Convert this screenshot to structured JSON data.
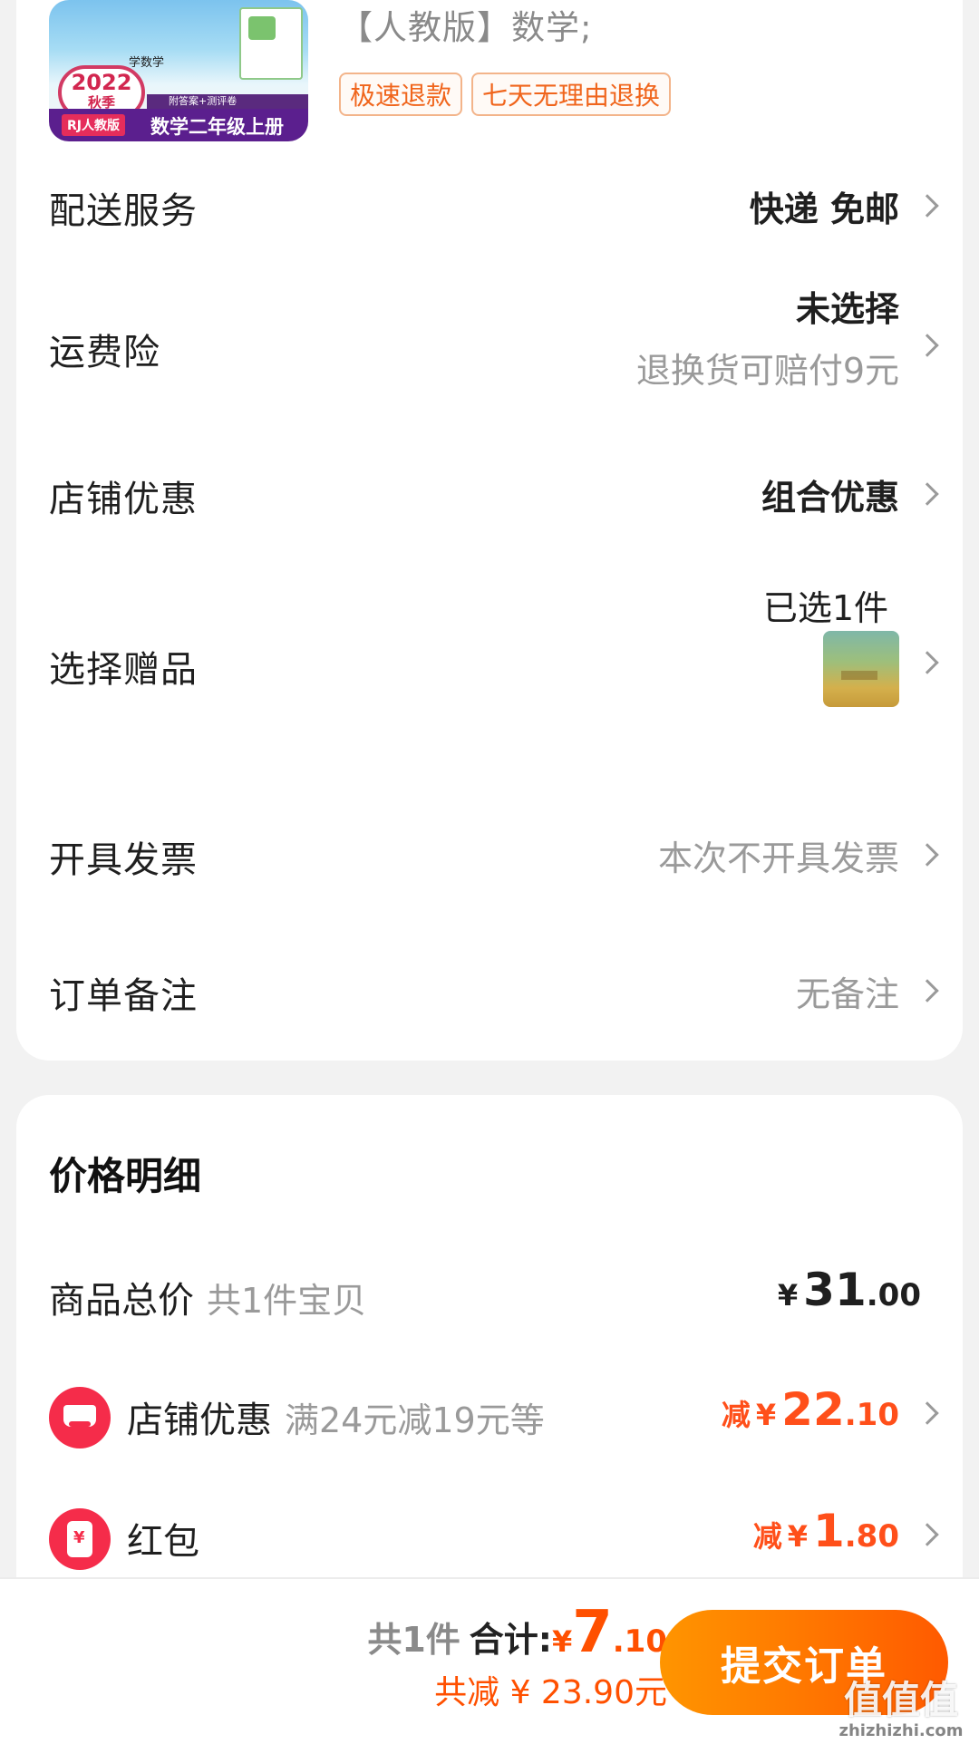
{
  "product": {
    "cover": {
      "badge_year": "2022",
      "badge_season": "秋季",
      "edition": "RJ人教版",
      "grade": "数学二年级上册",
      "subtitle": "学数学",
      "strip": "附答案+测评卷"
    },
    "spec": "【人教版】数学;",
    "tags": [
      "极速退款",
      "七天无理由退换"
    ]
  },
  "rows": {
    "delivery": {
      "label": "配送服务",
      "value": "快递 免邮"
    },
    "insurance": {
      "label": "运费险",
      "value": "未选择",
      "sub": "退换货可赔付9元"
    },
    "store_discount": {
      "label": "店铺优惠",
      "value": "组合优惠"
    },
    "gift": {
      "label": "选择赠品",
      "value": "已选1件"
    },
    "invoice": {
      "label": "开具发票",
      "value": "本次不开具发票"
    },
    "remark": {
      "label": "订单备注",
      "value": "无备注"
    }
  },
  "price_detail": {
    "title": "价格明细",
    "items": [
      {
        "label": "商品总价",
        "sub": "共1件宝贝",
        "prefix": "",
        "yen": "¥",
        "int": "31",
        "dec": ".00"
      },
      {
        "label": "店铺优惠",
        "sub": "满24元减19元等",
        "prefix": "减",
        "yen": "¥",
        "int": "22",
        "dec": ".10"
      },
      {
        "label": "红包",
        "sub": "",
        "prefix": "减",
        "yen": "¥",
        "int": "1",
        "dec": ".80"
      }
    ]
  },
  "bottom_bar": {
    "count": "共1件",
    "total_label": "合计:",
    "yen": "¥",
    "total_int": "7",
    "total_dec": ".10",
    "saved": "共减 ¥ 23.90元",
    "submit": "提交订单"
  },
  "watermark": {
    "main": "值值值",
    "sub": "zhizhizhi.com"
  },
  "colors": {
    "accent": "#ff5000",
    "shop_icon": "#f52c4a",
    "button_start": "#ff9500",
    "button_end": "#ff5a00"
  }
}
